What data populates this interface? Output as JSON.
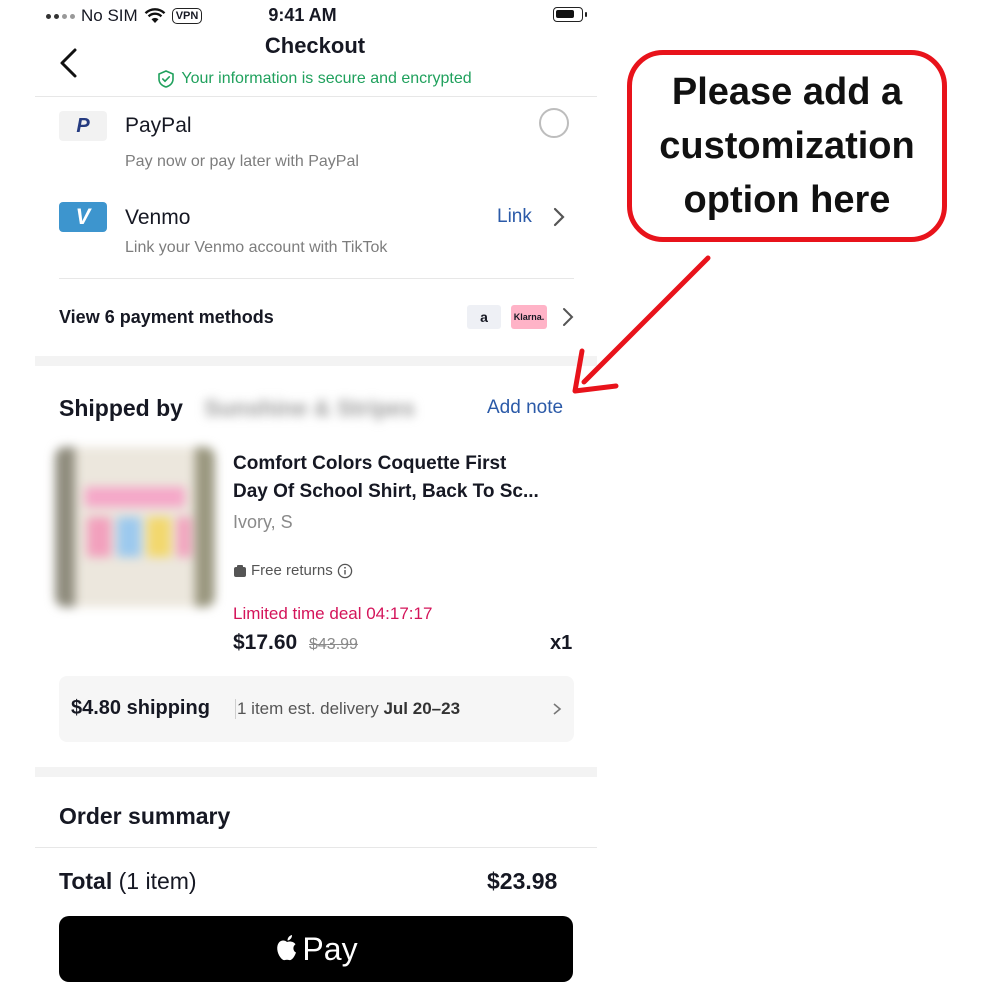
{
  "status_bar": {
    "carrier": "No SIM",
    "vpn": "VPN",
    "time": "9:41 AM"
  },
  "header": {
    "title": "Checkout",
    "secure_text": "Your information is secure and encrypted"
  },
  "payment_methods": [
    {
      "name": "PayPal",
      "subtitle": "Pay now or pay later with PayPal",
      "logo_text": "P",
      "logo_color": "#f2f2f2",
      "logo_fg": "#253b80"
    },
    {
      "name": "Venmo",
      "subtitle": "Link your Venmo account with TikTok",
      "action": "Link",
      "logo_text": "V",
      "logo_color": "#3d95ce",
      "logo_fg": "#ffffff"
    }
  ],
  "view_more": {
    "label": "View 6 payment methods",
    "badge_affirm": "a",
    "badge_klarna": "Klarna."
  },
  "shipped": {
    "label": "Shipped by",
    "seller": "Sunshine & Stripes",
    "add_note": "Add note"
  },
  "product": {
    "title_line1": "Comfort Colors Coquette First",
    "title_line2": "Day Of School Shirt, Back To Sc...",
    "variant": "Ivory, S",
    "free_returns": "Free returns",
    "deal": "Limited time deal 04:17:17",
    "price": "$17.60",
    "original_price": "$43.99",
    "qty": "x1"
  },
  "shipping": {
    "price": "$4.80 shipping",
    "delivery_prefix": "1 item est. delivery",
    "delivery_dates": "Jul 20–23"
  },
  "summary": {
    "title": "Order summary",
    "total_label": "Total",
    "total_count": "(1 item)",
    "total_value": "$23.98"
  },
  "pay_button": {
    "label": "Pay"
  },
  "annotation": {
    "text": "Please add a customization option here",
    "color": "#e8131b"
  },
  "colors": {
    "accent_link": "#2b5aa8",
    "secure_green": "#20a15d",
    "deal_pink": "#d4145a"
  }
}
